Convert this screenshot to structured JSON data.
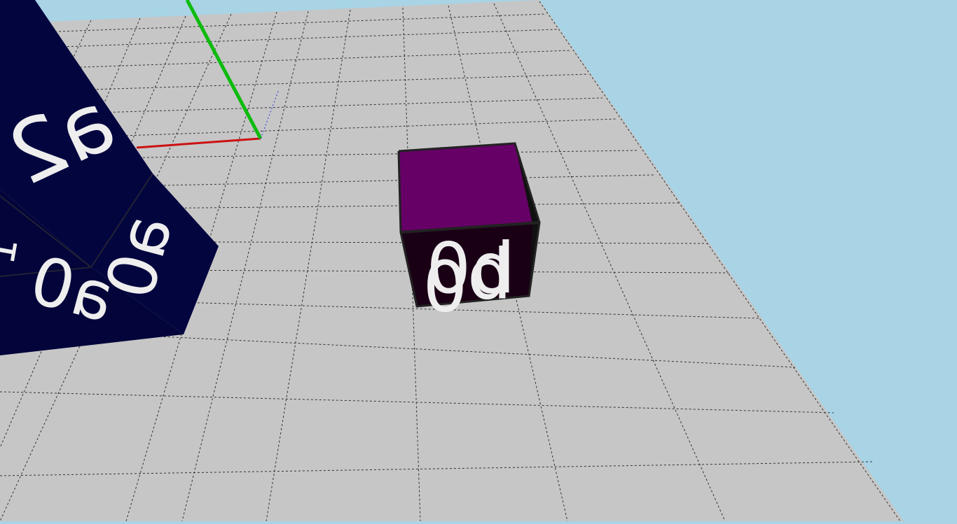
{
  "scene": {
    "colors": {
      "sky": "#a8d4e6",
      "floor": "#c6c6c6",
      "grid_line": "#1a1a1a",
      "axis_x": "#cc1111",
      "axis_y": "#0dbb0d",
      "axis_z": "#2233dd",
      "big_cube": "#03053f",
      "small_cube_top": "#660066",
      "small_cube_front": "#1a0015",
      "small_cube_side": "#101010",
      "face_text": "#eeeeee"
    },
    "big_cube": {
      "labels": {
        "top": "a2",
        "right": "a0",
        "bottom": "a0",
        "left_fragment": "1"
      }
    },
    "small_cube": {
      "labels": {
        "top": "p0",
        "front": "b0"
      }
    }
  }
}
